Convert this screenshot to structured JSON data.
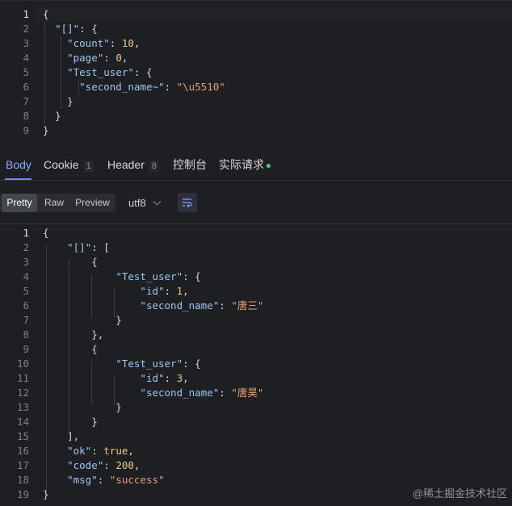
{
  "request_body": {
    "lines": [
      {
        "n": "1",
        "parts": [
          [
            "p",
            "{"
          ]
        ]
      },
      {
        "n": "2",
        "parts": [
          [
            "p",
            "  "
          ],
          [
            "k",
            "\"[]\""
          ],
          [
            "p",
            ": {"
          ]
        ]
      },
      {
        "n": "3",
        "parts": [
          [
            "p",
            "    "
          ],
          [
            "k",
            "\"count\""
          ],
          [
            "p",
            ": "
          ],
          [
            "n",
            "10"
          ],
          [
            "p",
            ","
          ]
        ]
      },
      {
        "n": "4",
        "parts": [
          [
            "p",
            "    "
          ],
          [
            "k",
            "\"page\""
          ],
          [
            "p",
            ": "
          ],
          [
            "n",
            "0"
          ],
          [
            "p",
            ","
          ]
        ]
      },
      {
        "n": "5",
        "parts": [
          [
            "p",
            "    "
          ],
          [
            "k",
            "\"Test_user\""
          ],
          [
            "p",
            ": {"
          ]
        ]
      },
      {
        "n": "6",
        "parts": [
          [
            "p",
            "      "
          ],
          [
            "k",
            "\"second_name~\""
          ],
          [
            "p",
            ": "
          ],
          [
            "s",
            "\"\\u5510\""
          ]
        ]
      },
      {
        "n": "7",
        "parts": [
          [
            "p",
            "    }"
          ]
        ]
      },
      {
        "n": "8",
        "parts": [
          [
            "p",
            "  }"
          ]
        ]
      },
      {
        "n": "9",
        "parts": [
          [
            "p",
            "}"
          ]
        ]
      }
    ]
  },
  "tabs": [
    {
      "label": "Body",
      "active": true
    },
    {
      "label": "Cookie",
      "badge": "1"
    },
    {
      "label": "Header",
      "badge": "8"
    },
    {
      "label": "控制台"
    },
    {
      "label": "实际请求",
      "dot": true
    }
  ],
  "toolbar": {
    "modes": [
      "Pretty",
      "Raw",
      "Preview"
    ],
    "active_mode": "Pretty",
    "encoding": "utf8"
  },
  "response_body": {
    "lines": [
      {
        "n": "1",
        "parts": [
          [
            "p",
            "{"
          ]
        ]
      },
      {
        "n": "2",
        "parts": [
          [
            "p",
            "    "
          ],
          [
            "k",
            "\"[]\""
          ],
          [
            "p",
            ": ["
          ]
        ]
      },
      {
        "n": "3",
        "parts": [
          [
            "p",
            "        {"
          ]
        ]
      },
      {
        "n": "4",
        "parts": [
          [
            "p",
            "            "
          ],
          [
            "k",
            "\"Test_user\""
          ],
          [
            "p",
            ": {"
          ]
        ]
      },
      {
        "n": "5",
        "parts": [
          [
            "p",
            "                "
          ],
          [
            "k",
            "\"id\""
          ],
          [
            "p",
            ": "
          ],
          [
            "n",
            "1"
          ],
          [
            "p",
            ","
          ]
        ]
      },
      {
        "n": "6",
        "parts": [
          [
            "p",
            "                "
          ],
          [
            "k",
            "\"second_name\""
          ],
          [
            "p",
            ": "
          ],
          [
            "s",
            "\"唐三\""
          ]
        ]
      },
      {
        "n": "7",
        "parts": [
          [
            "p",
            "            }"
          ]
        ]
      },
      {
        "n": "8",
        "parts": [
          [
            "p",
            "        },"
          ]
        ]
      },
      {
        "n": "9",
        "parts": [
          [
            "p",
            "        {"
          ]
        ]
      },
      {
        "n": "10",
        "parts": [
          [
            "p",
            "            "
          ],
          [
            "k",
            "\"Test_user\""
          ],
          [
            "p",
            ": {"
          ]
        ]
      },
      {
        "n": "11",
        "parts": [
          [
            "p",
            "                "
          ],
          [
            "k",
            "\"id\""
          ],
          [
            "p",
            ": "
          ],
          [
            "n",
            "3"
          ],
          [
            "p",
            ","
          ]
        ]
      },
      {
        "n": "12",
        "parts": [
          [
            "p",
            "                "
          ],
          [
            "k",
            "\"second_name\""
          ],
          [
            "p",
            ": "
          ],
          [
            "s",
            "\"唐昊\""
          ]
        ]
      },
      {
        "n": "13",
        "parts": [
          [
            "p",
            "            }"
          ]
        ]
      },
      {
        "n": "14",
        "parts": [
          [
            "p",
            "        }"
          ]
        ]
      },
      {
        "n": "15",
        "parts": [
          [
            "p",
            "    ],"
          ]
        ]
      },
      {
        "n": "16",
        "parts": [
          [
            "p",
            "    "
          ],
          [
            "k",
            "\"ok\""
          ],
          [
            "p",
            ": "
          ],
          [
            "kw",
            "true"
          ],
          [
            "p",
            ","
          ]
        ]
      },
      {
        "n": "17",
        "parts": [
          [
            "p",
            "    "
          ],
          [
            "k",
            "\"code\""
          ],
          [
            "p",
            ": "
          ],
          [
            "n",
            "200"
          ],
          [
            "p",
            ","
          ]
        ]
      },
      {
        "n": "18",
        "parts": [
          [
            "p",
            "    "
          ],
          [
            "k",
            "\"msg\""
          ],
          [
            "p",
            ": "
          ],
          [
            "s",
            "\"success\""
          ]
        ]
      },
      {
        "n": "19",
        "parts": [
          [
            "p",
            "}"
          ]
        ]
      }
    ]
  },
  "watermark": "@稀土掘金技术社区"
}
